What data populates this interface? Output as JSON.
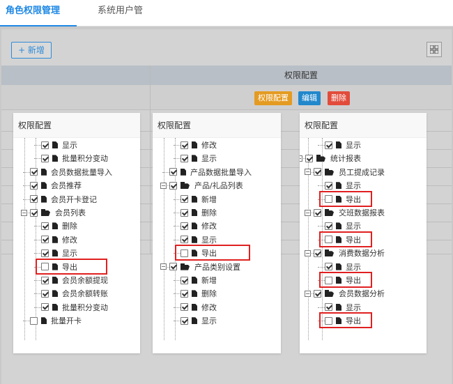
{
  "tabs": [
    {
      "label": "角色权限管理",
      "active": true
    },
    {
      "label": "系统用户管",
      "active": false
    }
  ],
  "toolbar": {
    "add_label": "+ 新增",
    "grid_icon": "grid-icon"
  },
  "table": {
    "header_title": "权限配置",
    "actions": [
      {
        "label": "权限配置",
        "color": "#e49b22"
      },
      {
        "label": "编辑",
        "color": "#2288cc"
      },
      {
        "label": "删除",
        "color": "#e24c3b"
      }
    ]
  },
  "dialogs": [
    {
      "title": "权限配置",
      "nodes": [
        {
          "label": "显示",
          "level": 2,
          "type": "file",
          "checked": true
        },
        {
          "label": "批量积分变动",
          "level": 2,
          "type": "file",
          "checked": true
        },
        {
          "label": "会员数据批量导入",
          "level": 1,
          "type": "file",
          "checked": true
        },
        {
          "label": "会员推荐",
          "level": 1,
          "type": "file",
          "checked": true
        },
        {
          "label": "会员开卡登记",
          "level": 1,
          "type": "file",
          "checked": true
        },
        {
          "label": "会员列表",
          "level": 1,
          "type": "folder",
          "checked": true,
          "toggle": "−"
        },
        {
          "label": "删除",
          "level": 2,
          "type": "file",
          "checked": true
        },
        {
          "label": "修改",
          "level": 2,
          "type": "file",
          "checked": true
        },
        {
          "label": "显示",
          "level": 2,
          "type": "file",
          "checked": true
        },
        {
          "label": "导出",
          "level": 2,
          "type": "file",
          "checked": false,
          "highlight": true
        },
        {
          "label": "会员余额提现",
          "level": 2,
          "type": "file",
          "checked": true
        },
        {
          "label": "会员余额转账",
          "level": 2,
          "type": "file",
          "checked": true
        },
        {
          "label": "批量积分变动",
          "level": 2,
          "type": "file",
          "checked": true
        },
        {
          "label": "批量开卡",
          "level": 1,
          "type": "file",
          "checked": false
        }
      ]
    },
    {
      "title": "权限配置",
      "nodes": [
        {
          "label": "修改",
          "level": 2,
          "type": "file",
          "checked": true
        },
        {
          "label": "显示",
          "level": 2,
          "type": "file",
          "checked": true
        },
        {
          "label": "产品数据批量导入",
          "level": 1,
          "type": "file",
          "checked": true
        },
        {
          "label": "产品/礼品列表",
          "level": 1,
          "type": "folder",
          "checked": true,
          "toggle": "−"
        },
        {
          "label": "新增",
          "level": 2,
          "type": "file",
          "checked": true
        },
        {
          "label": "删除",
          "level": 2,
          "type": "file",
          "checked": true
        },
        {
          "label": "修改",
          "level": 2,
          "type": "file",
          "checked": true
        },
        {
          "label": "显示",
          "level": 2,
          "type": "file",
          "checked": true
        },
        {
          "label": "导出",
          "level": 2,
          "type": "file",
          "checked": false,
          "highlight": true
        },
        {
          "label": "产品类别设置",
          "level": 1,
          "type": "folder",
          "checked": true,
          "toggle": "−"
        },
        {
          "label": "新增",
          "level": 2,
          "type": "file",
          "checked": true
        },
        {
          "label": "删除",
          "level": 2,
          "type": "file",
          "checked": true
        },
        {
          "label": "修改",
          "level": 2,
          "type": "file",
          "checked": true
        },
        {
          "label": "显示",
          "level": 2,
          "type": "file",
          "checked": true
        }
      ]
    },
    {
      "title": "权限配置",
      "nodes": [
        {
          "label": "显示",
          "level": 2,
          "type": "file",
          "checked": true
        },
        {
          "label": "统计报表",
          "level": 0,
          "type": "folder",
          "checked": true,
          "toggle": "−"
        },
        {
          "label": "员工提成记录",
          "level": 1,
          "type": "folder",
          "checked": true,
          "toggle": "−"
        },
        {
          "label": "显示",
          "level": 2,
          "type": "file",
          "checked": true
        },
        {
          "label": "导出",
          "level": 2,
          "type": "file",
          "checked": false,
          "highlight": true
        },
        {
          "label": "交班数据报表",
          "level": 1,
          "type": "folder",
          "checked": true,
          "toggle": "−"
        },
        {
          "label": "显示",
          "level": 2,
          "type": "file",
          "checked": true
        },
        {
          "label": "导出",
          "level": 2,
          "type": "file",
          "checked": false,
          "highlight": true
        },
        {
          "label": "消费数据分析",
          "level": 1,
          "type": "folder",
          "checked": true,
          "toggle": "−"
        },
        {
          "label": "显示",
          "level": 2,
          "type": "file",
          "checked": true
        },
        {
          "label": "导出",
          "level": 2,
          "type": "file",
          "checked": false,
          "highlight": true
        },
        {
          "label": "会员数据分析",
          "level": 1,
          "type": "folder",
          "checked": true,
          "toggle": "−"
        },
        {
          "label": "显示",
          "level": 2,
          "type": "file",
          "checked": true
        },
        {
          "label": "导出",
          "level": 2,
          "type": "file",
          "checked": false,
          "highlight": true
        }
      ]
    }
  ]
}
